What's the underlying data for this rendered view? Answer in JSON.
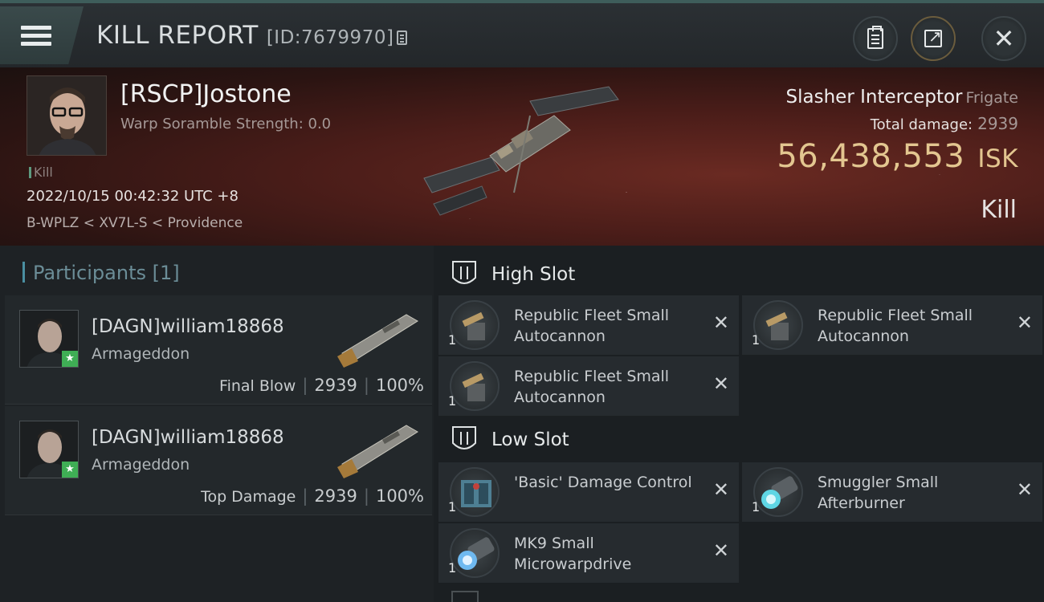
{
  "header": {
    "title": "KILL REPORT",
    "report_id": "[ID:7679970]"
  },
  "victim": {
    "name": "[RSCP]Jostone",
    "scramble": "Warp Soramble Strength: 0.0",
    "tag": "Kill",
    "datetime": "2022/10/15 00:42:32 UTC +8",
    "location": "B-WPLZ < XV7L-S < Providence",
    "ship_name": "Slasher Interceptor",
    "ship_class": "Frigate",
    "total_damage_label": "Total damage:",
    "total_damage": "2939",
    "isk_value": "56,438,553",
    "isk_unit": "ISK",
    "result": "Kill"
  },
  "participants": {
    "label": "Participants [1]",
    "rows": [
      {
        "name": "[DAGN]william18868",
        "ship": "Armageddon",
        "role": "Final Blow",
        "damage": "2939",
        "percent": "100%"
      },
      {
        "name": "[DAGN]william18868",
        "ship": "Armageddon",
        "role": "Top Damage",
        "damage": "2939",
        "percent": "100%"
      }
    ]
  },
  "fitting": {
    "high_slot_label": "High Slot",
    "low_slot_label": "Low Slot",
    "high": [
      {
        "qty": "1",
        "name": "Republic Fleet Small Autocannon"
      },
      {
        "qty": "1",
        "name": "Republic Fleet Small Autocannon"
      },
      {
        "qty": "1",
        "name": "Republic Fleet Small Autocannon"
      }
    ],
    "low": [
      {
        "qty": "1",
        "name": "'Basic' Damage Control"
      },
      {
        "qty": "1",
        "name": "Smuggler Small Afterburner"
      },
      {
        "qty": "1",
        "name": "MK9 Small Microwarpdrive"
      }
    ]
  },
  "colors": {
    "isk_gold": "#e3c690",
    "accent_teal": "#4a8fa1",
    "badge_green": "#3fae55"
  }
}
